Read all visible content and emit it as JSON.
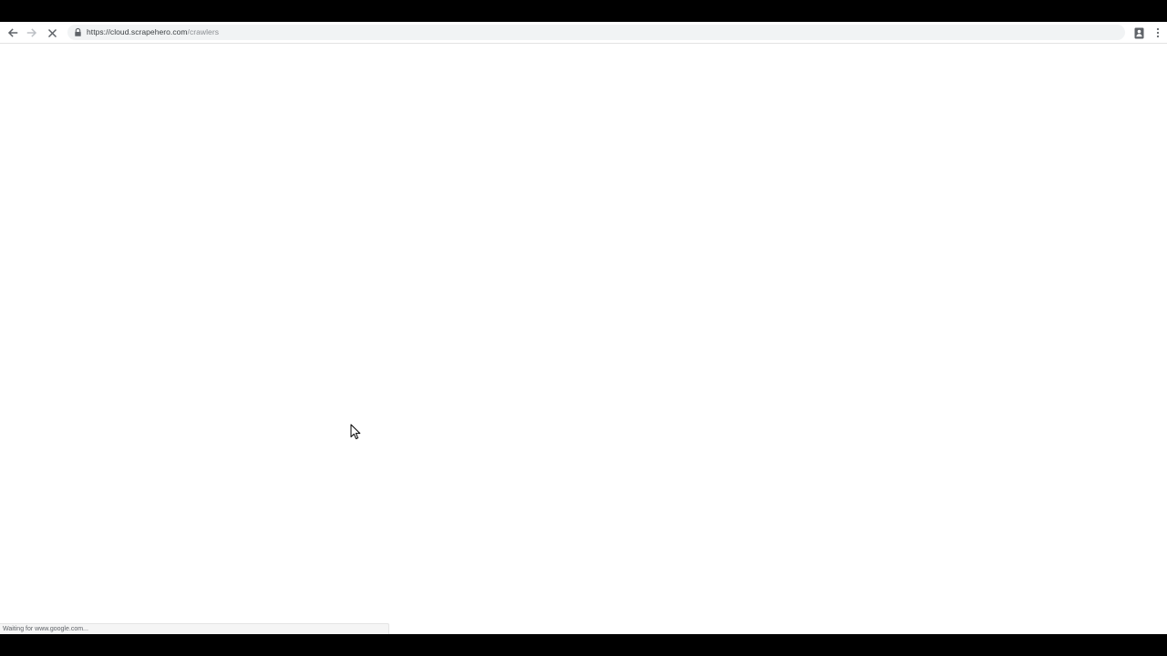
{
  "browser": {
    "url_host": "https://cloud.scrapehero.com",
    "url_path": "/crawlers",
    "status_text": "Waiting for www.google.com..."
  },
  "icons": {
    "back": "arrow-left-icon",
    "forward": "arrow-right-icon",
    "stop": "close-icon",
    "lock": "lock-icon",
    "profile": "profile-icon",
    "menu": "kebab-menu-icon",
    "cursor": "mouse-pointer-icon"
  },
  "colors": {
    "toolbar_bg": "#ffffff",
    "omnibox_bg": "#f1f3f4",
    "icon": "#5f6368",
    "icon_disabled": "#bdc1c6",
    "page_bg": "#ffffff",
    "letterbox": "#000000"
  }
}
